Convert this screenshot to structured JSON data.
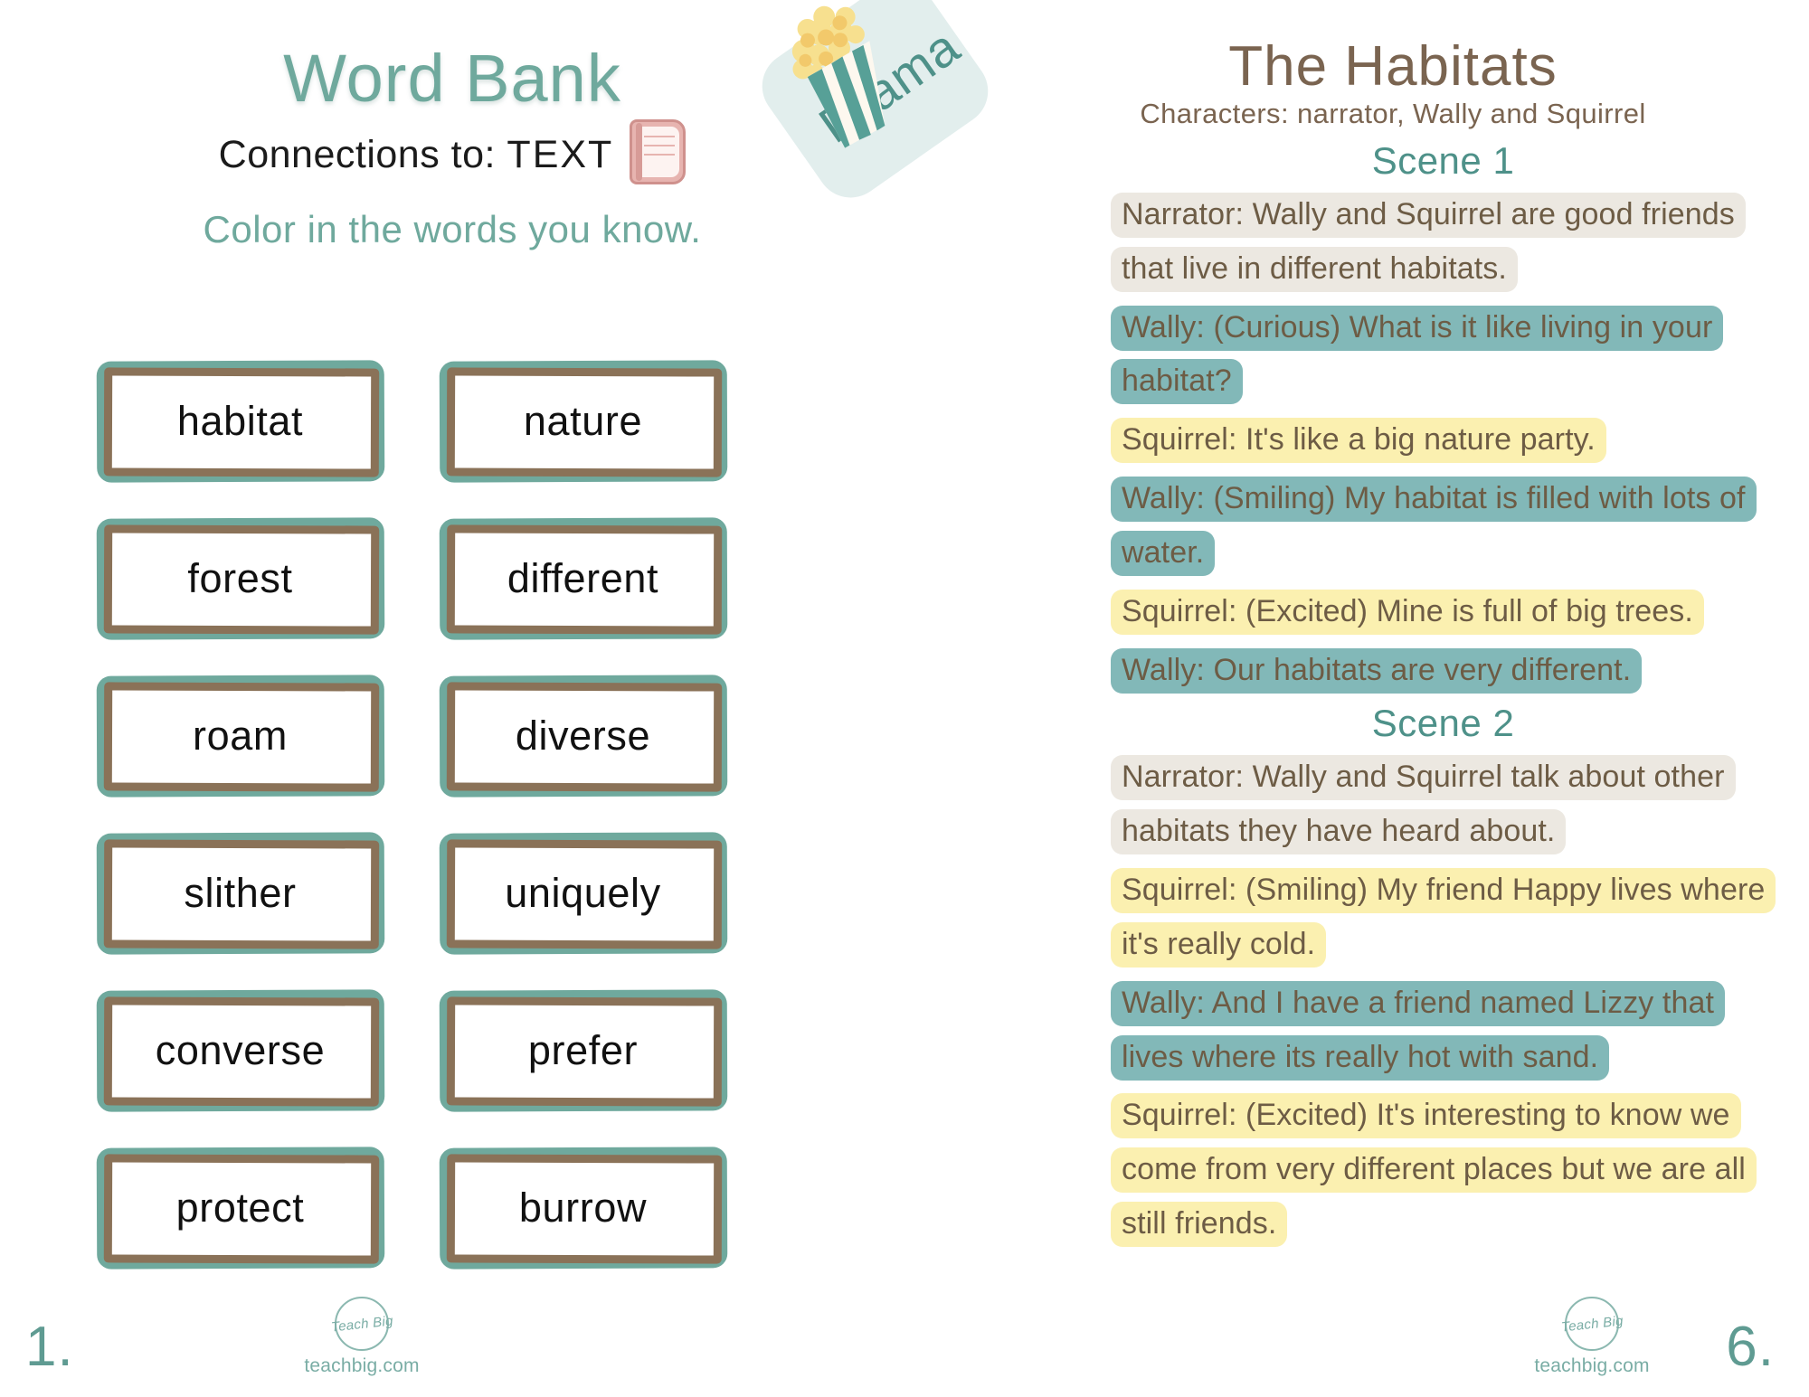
{
  "left_page": {
    "title": "Word Bank",
    "subtitle_prefix": "Connections to:",
    "subtitle_target": "TEXT",
    "instruction": "Color in the words you know.",
    "book_icon": "book-icon",
    "words": [
      "habitat",
      "nature",
      "forest",
      "different",
      "roam",
      "diverse",
      "slither",
      "uniquely",
      "converse",
      "prefer",
      "protect",
      "burrow"
    ],
    "page_number": "1.",
    "brand": {
      "mark": "Teach Big",
      "url": "teachbig.com"
    }
  },
  "right_page": {
    "badge_label": "Drama",
    "badge_icon": "popcorn-icon",
    "title": "The Habitats",
    "characters": "Characters: narrator, Wally and Squirrel",
    "scenes": [
      {
        "heading": "Scene 1",
        "lines": [
          {
            "speaker": "narrator",
            "text": "Narrator: Wally and Squirrel are good friends that live in different habitats."
          },
          {
            "speaker": "wally",
            "text": "Wally: (Curious) What is it like living in your habitat?"
          },
          {
            "speaker": "squirrel",
            "text": "Squirrel: It's like a big nature party."
          },
          {
            "speaker": "wally",
            "text": "Wally: (Smiling) My habitat is filled with lots of water."
          },
          {
            "speaker": "squirrel",
            "text": "Squirrel: (Excited) Mine is full of big trees."
          },
          {
            "speaker": "wally",
            "text": "Wally: Our habitats are very different."
          }
        ]
      },
      {
        "heading": "Scene 2",
        "lines": [
          {
            "speaker": "narrator",
            "text": "Narrator: Wally and Squirrel talk about other habitats they have heard about."
          },
          {
            "speaker": "squirrel",
            "text": "Squirrel: (Smiling) My friend Happy lives where it's really cold."
          },
          {
            "speaker": "wally",
            "text": "Wally: And I have a friend named Lizzy that lives where its really hot with sand."
          },
          {
            "speaker": "squirrel",
            "text": "Squirrel: (Excited) It's interesting to know we come from very different places but we are all still friends."
          }
        ]
      }
    ],
    "page_number": "6.",
    "brand": {
      "mark": "Teach Big",
      "url": "teachbig.com"
    }
  },
  "colors": {
    "teal": "#6fa99d",
    "teal_dark": "#4e9189",
    "brown": "#7a6450",
    "box_brown": "#8a7258",
    "highlight_wally": "#82b8b8",
    "highlight_squirrel": "#fbf0b0",
    "highlight_narrator": "#ece8e1",
    "badge_bg": "#e2eeed",
    "book_pink": "#e7b4b0"
  }
}
